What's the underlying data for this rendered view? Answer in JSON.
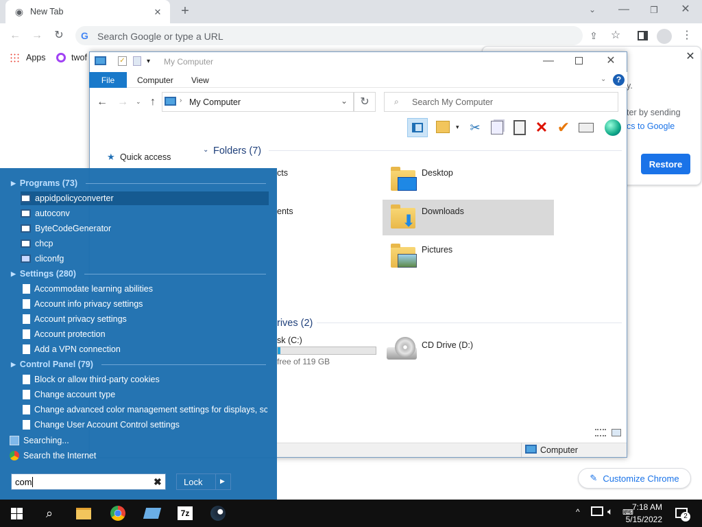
{
  "chrome": {
    "tab_title": "New Tab",
    "omnibox_placeholder": "Search Google or type a URL",
    "bookmarks": [
      {
        "label": "Apps"
      },
      {
        "label": "twof"
      }
    ],
    "notice_text_1": "y.",
    "notice_text_2": "ter by sending",
    "notice_text_3": "cs to Google",
    "restore_label": "Restore",
    "customize_label": "Customize Chrome"
  },
  "explorer": {
    "title": "My Computer",
    "ribbon_tabs": [
      "File",
      "Computer",
      "View"
    ],
    "address": "My Computer",
    "search_placeholder": "Search My Computer",
    "quick_access": "Quick access",
    "folders_header": "Folders (7)",
    "folders_partial": [
      "cts",
      "ents"
    ],
    "folders": [
      {
        "label": "Desktop"
      },
      {
        "label": "Downloads"
      },
      {
        "label": "Pictures"
      }
    ],
    "drives_header": "rives (2)",
    "drive_c_label": "sk (C:)",
    "drive_c_free": "free of 119 GB",
    "drive_c_used_fraction": 0.03,
    "drive_d_label": "CD Drive (D:)",
    "status_location": "Computer"
  },
  "startmenu": {
    "programs_header": "Programs (73)",
    "programs": [
      "appidpolicyconverter",
      "autoconv",
      "ByteCodeGenerator",
      "chcp",
      "cliconfg"
    ],
    "settings_header": "Settings (280)",
    "settings": [
      "Accommodate learning abilities",
      "Account info privacy settings",
      "Account privacy settings",
      "Account protection",
      "Add a VPN connection"
    ],
    "control_header": "Control Panel (79)",
    "control": [
      "Block or allow third-party cookies",
      "Change account type",
      "Change advanced color management settings for displays, sca...",
      "Change User Account Control settings"
    ],
    "searching": "Searching...",
    "search_internet": "Search the Internet",
    "search_value": "com",
    "lock_label": "Lock"
  },
  "taskbar": {
    "time": "7:18 AM",
    "date": "5/15/2022",
    "notification_count": "2"
  },
  "colors": {
    "accent": "#1a73e8",
    "start_bg": "#1e6fb0",
    "file_tab": "#1979ca"
  }
}
